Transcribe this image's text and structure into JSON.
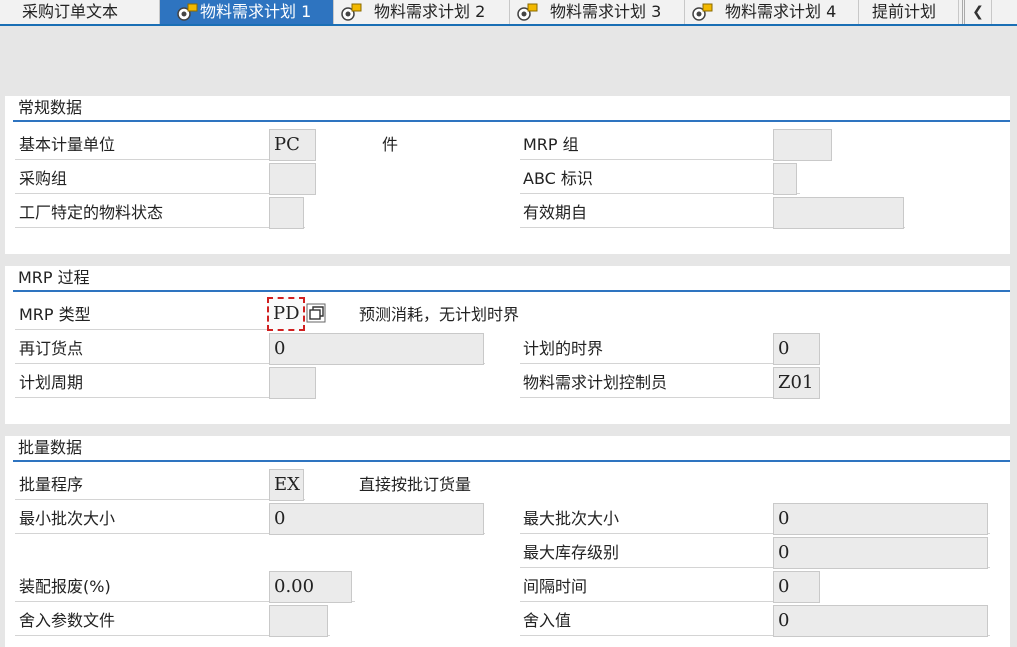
{
  "tabs": [
    {
      "label": "采购订单文本",
      "active": false
    },
    {
      "label": "物料需求计划 1",
      "active": true
    },
    {
      "label": "物料需求计划 2",
      "active": false
    },
    {
      "label": "物料需求计划 3",
      "active": false
    },
    {
      "label": "物料需求计划 4",
      "active": false
    },
    {
      "label": "提前计划",
      "active": false
    }
  ],
  "general": {
    "title": "常规数据",
    "base_uom_label": "基本计量单位",
    "base_uom_value": "PC",
    "base_uom_desc": "件",
    "mrp_group_label": "MRP 组",
    "mrp_group_value": "",
    "purch_group_label": "采购组",
    "purch_group_value": "",
    "abc_label": "ABC 标识",
    "abc_value": "",
    "plant_status_label": "工厂特定的物料状态",
    "plant_status_value": "",
    "valid_from_label": "有效期自",
    "valid_from_value": ""
  },
  "mrp": {
    "title": "MRP 过程",
    "type_label": "MRP 类型",
    "type_value": "PD",
    "type_desc": "预测消耗，无计划时界",
    "reorder_label": "再订货点",
    "reorder_value": "0",
    "fence_label": "计划的时界",
    "fence_value": "0",
    "cycle_label": "计划周期",
    "cycle_value": "",
    "controller_label": "物料需求计划控制员",
    "controller_value": "Z01"
  },
  "lot": {
    "title": "批量数据",
    "proc_label": "批量程序",
    "proc_value": "EX",
    "proc_desc": "直接按批订货量",
    "min_label": "最小批次大小",
    "min_value": "0",
    "max_label": "最大批次大小",
    "max_value": "0",
    "maxstock_label": "最大库存级别",
    "maxstock_value": "0",
    "scrap_label": "装配报废(%)",
    "scrap_value": "0.00",
    "interval_label": "间隔时间",
    "interval_value": "0",
    "round_profile_label": "舍入参数文件",
    "round_profile_value": "",
    "round_value_label": "舍入值",
    "round_value_value": "0"
  },
  "colors": {
    "accent": "#2e74c0",
    "field_bg": "#ebebeb",
    "focus": "#d02020"
  }
}
